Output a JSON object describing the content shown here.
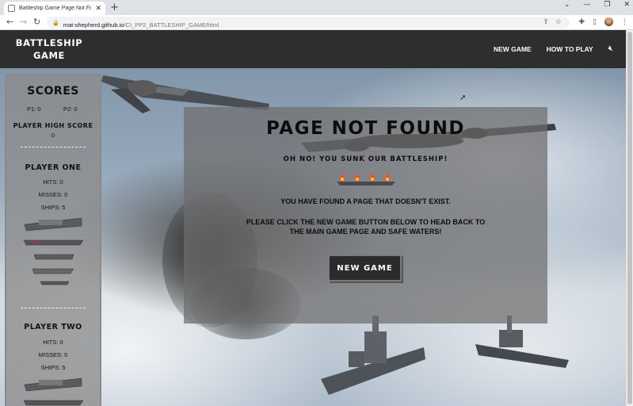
{
  "browser": {
    "tab_title": "Battleship Game Page Not Found",
    "new_tab_symbol": "+",
    "url_host": "mat-shepherd.github.io",
    "url_path": "/CI_PP2_BATTLESHIP_GAME/html",
    "icons": [
      "back-icon",
      "forward-icon",
      "reload-icon",
      "lock-icon",
      "share-icon",
      "star-icon",
      "extensions-icon",
      "sidepanel-icon",
      "profile-avatar",
      "kebab-menu-icon"
    ]
  },
  "navbar": {
    "brand_line1": "BATTLESHIP",
    "brand_line2": "GAME",
    "links": [
      "NEW GAME",
      "HOW TO PLAY"
    ],
    "mute_icon": "speaker-muted-icon"
  },
  "sidebar": {
    "scores_title": "SCORES",
    "p1_label": "P1:",
    "p1_score": "0",
    "p2_label": "P2:",
    "p2_score": "0",
    "high_score_title": "PLAYER HIGH SCORE",
    "high_score_value": "0",
    "player_one": {
      "title": "PLAYER ONE",
      "hits": "HITS: 0",
      "misses": "MISSES: 0",
      "ships": "SHIPS: 5"
    },
    "player_two": {
      "title": "PLAYER TWO",
      "hits": "HITS: 0",
      "misses": "MISSES: 0",
      "ships": "SHIPS: 5"
    }
  },
  "modal": {
    "title": "PAGE NOT FOUND",
    "subtitle": "OH NO! YOU SUNK OUR BATTLESHIP!",
    "line1": "YOU HAVE FOUND A PAGE THAT DOESN'T EXIST.",
    "line2": "PLEASE CLICK THE NEW GAME BUTTON BELOW TO HEAD BACK TO",
    "line3": "THE MAIN GAME PAGE AND SAFE WATERS!",
    "button_label": "NEW GAME",
    "fire_icon": "burning-ship-icon"
  }
}
